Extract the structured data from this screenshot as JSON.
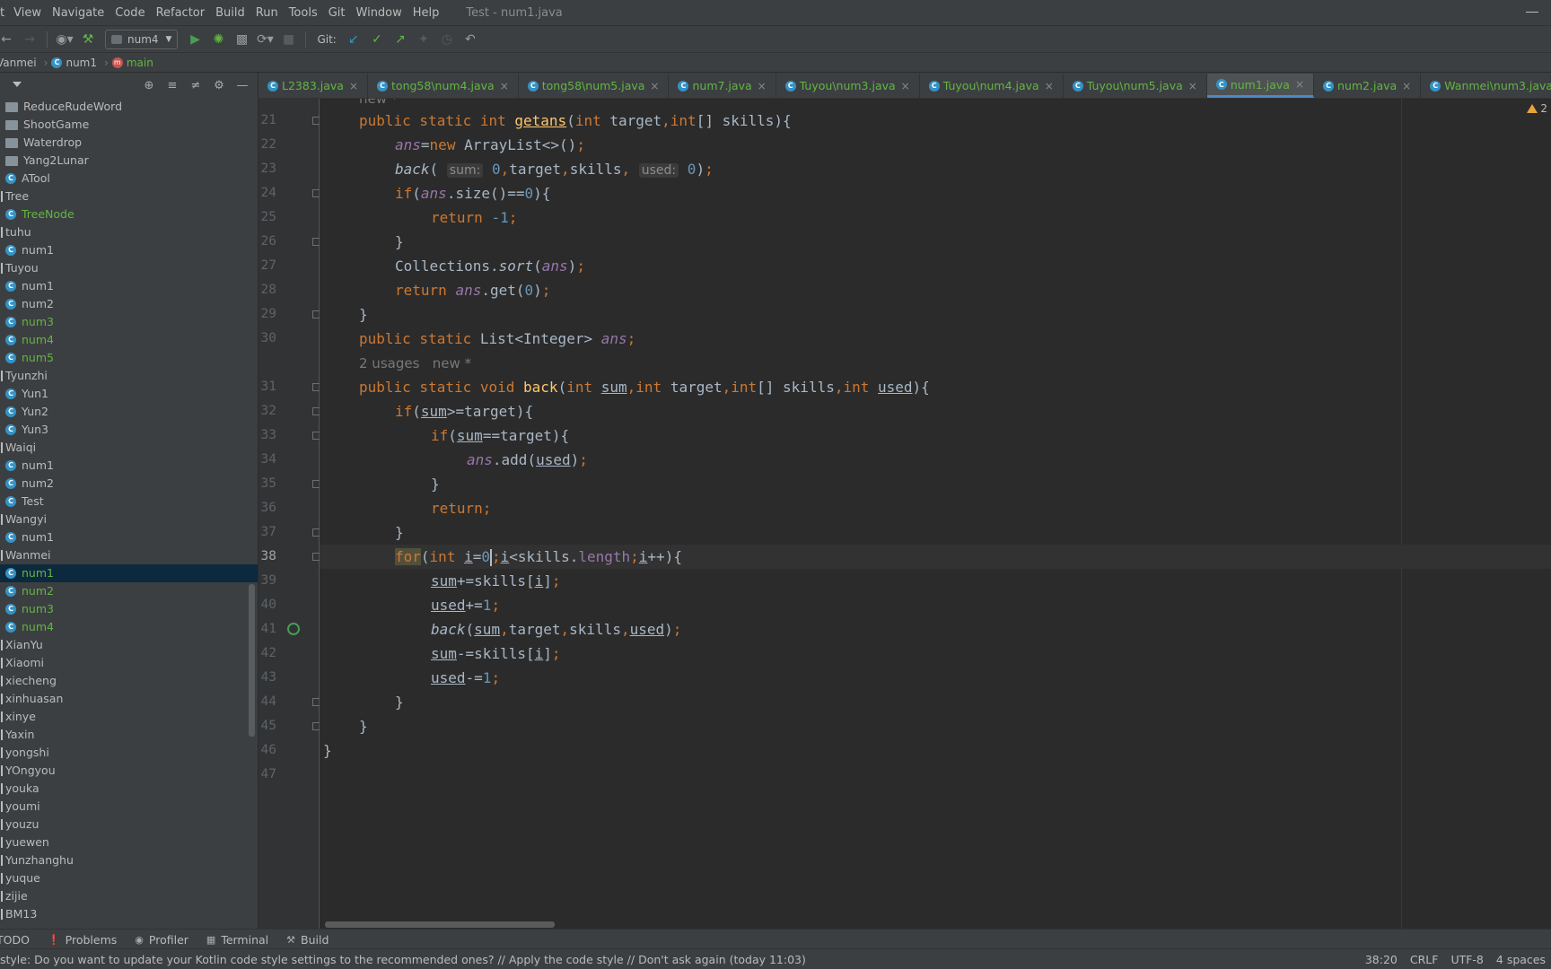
{
  "menu": {
    "items": [
      "t",
      "View",
      "Navigate",
      "Code",
      "Refactor",
      "Build",
      "Run",
      "Tools",
      "Git",
      "Window",
      "Help"
    ],
    "window_title": "Test - num1.java"
  },
  "toolbar": {
    "run_config": "num4",
    "git_label": "Git:"
  },
  "breadcrumb": {
    "items": [
      "Vanmei",
      "num1",
      "main"
    ]
  },
  "project_tree": {
    "items": [
      {
        "label": "ReduceRudeWord",
        "type": "folder"
      },
      {
        "label": "ShootGame",
        "type": "folder"
      },
      {
        "label": "Waterdrop",
        "type": "folder"
      },
      {
        "label": "Yang2Lunar",
        "type": "folder"
      },
      {
        "label": "ATool",
        "type": "class"
      },
      {
        "label": "Tree",
        "type": "package"
      },
      {
        "label": "TreeNode",
        "type": "class-vcs"
      },
      {
        "label": "tuhu",
        "type": "package"
      },
      {
        "label": "num1",
        "type": "class"
      },
      {
        "label": "Tuyou",
        "type": "package"
      },
      {
        "label": "num1",
        "type": "class"
      },
      {
        "label": "num2",
        "type": "class"
      },
      {
        "label": "num3",
        "type": "class-vcs"
      },
      {
        "label": "num4",
        "type": "class-vcs"
      },
      {
        "label": "num5",
        "type": "class-vcs"
      },
      {
        "label": "Tyunzhi",
        "type": "package"
      },
      {
        "label": "Yun1",
        "type": "class"
      },
      {
        "label": "Yun2",
        "type": "class"
      },
      {
        "label": "Yun3",
        "type": "class"
      },
      {
        "label": "Waiqi",
        "type": "package"
      },
      {
        "label": "num1",
        "type": "class"
      },
      {
        "label": "num2",
        "type": "class"
      },
      {
        "label": "Test",
        "type": "class"
      },
      {
        "label": "Wangyi",
        "type": "package"
      },
      {
        "label": "num1",
        "type": "class"
      },
      {
        "label": "Wanmei",
        "type": "package"
      },
      {
        "label": "num1",
        "type": "class-vcs-selected"
      },
      {
        "label": "num2",
        "type": "class-vcs"
      },
      {
        "label": "num3",
        "type": "class-vcs"
      },
      {
        "label": "num4",
        "type": "class-vcs"
      },
      {
        "label": "XianYu",
        "type": "package"
      },
      {
        "label": "Xiaomi",
        "type": "package"
      },
      {
        "label": "xiecheng",
        "type": "package"
      },
      {
        "label": "xinhuasan",
        "type": "package"
      },
      {
        "label": "xinye",
        "type": "package"
      },
      {
        "label": "Yaxin",
        "type": "package"
      },
      {
        "label": "yongshi",
        "type": "package"
      },
      {
        "label": "YOngyou",
        "type": "package"
      },
      {
        "label": "youka",
        "type": "package"
      },
      {
        "label": "youmi",
        "type": "package"
      },
      {
        "label": "youzu",
        "type": "package"
      },
      {
        "label": "yuewen",
        "type": "package"
      },
      {
        "label": "Yunzhanghu",
        "type": "package"
      },
      {
        "label": "yuque",
        "type": "package"
      },
      {
        "label": "zijie",
        "type": "package"
      },
      {
        "label": "BM13",
        "type": "package"
      }
    ]
  },
  "tabs": [
    {
      "label": "L2383.java",
      "active": false
    },
    {
      "label": "tong58\\num4.java",
      "active": false
    },
    {
      "label": "tong58\\num5.java",
      "active": false
    },
    {
      "label": "num7.java",
      "active": false
    },
    {
      "label": "Tuyou\\num3.java",
      "active": false
    },
    {
      "label": "Tuyou\\num4.java",
      "active": false
    },
    {
      "label": "Tuyou\\num5.java",
      "active": false
    },
    {
      "label": "num1.java",
      "active": true
    },
    {
      "label": "num2.java",
      "active": false
    },
    {
      "label": "Wanmei\\num3.java",
      "active": false
    }
  ],
  "editor": {
    "warning_count": "2",
    "hint_new": "new *",
    "hint_usages": "2 usages",
    "lines": [
      "21",
      "22",
      "23",
      "24",
      "25",
      "26",
      "27",
      "28",
      "29",
      "30",
      "31",
      "32",
      "33",
      "34",
      "35",
      "36",
      "37",
      "38",
      "39",
      "40",
      "41",
      "42",
      "43",
      "44",
      "45",
      "46",
      "47"
    ],
    "current_line": "38",
    "inlay_sum": "sum:",
    "inlay_used": "used:"
  },
  "tool_windows": [
    "TODO",
    "Problems",
    "Profiler",
    "Terminal",
    "Build"
  ],
  "status": {
    "message": "style: Do you want to update your Kotlin code style settings to the recommended ones? // Apply the code style // Don't ask again (today 11:03)",
    "position": "38:20",
    "line_sep": "CRLF",
    "encoding": "UTF-8",
    "indent": "4 spaces"
  },
  "colors": {
    "keyword": "#cc7832",
    "method": "#ffc66d",
    "field": "#9876aa",
    "number": "#6897bb",
    "vcs_added": "#62b543",
    "selection": "#0d293e"
  }
}
